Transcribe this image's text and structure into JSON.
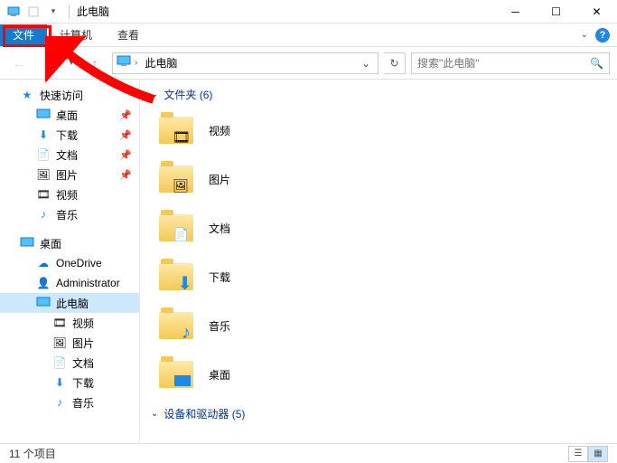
{
  "window": {
    "title": "此电脑"
  },
  "ribbon": {
    "file": "文件",
    "computer": "计算机",
    "view": "查看"
  },
  "address": {
    "crumb": "此电脑",
    "search_placeholder": "搜索\"此电脑\""
  },
  "nav": {
    "quick_access": "快速访问",
    "desktop": "桌面",
    "downloads": "下载",
    "documents": "文档",
    "pictures": "图片",
    "videos": "视频",
    "music": "音乐",
    "desktop2": "桌面",
    "onedrive": "OneDrive",
    "admin": "Administrator",
    "thispc": "此电脑",
    "nav_videos": "视频",
    "nav_pictures": "图片",
    "nav_documents": "文档",
    "nav_downloads": "下载",
    "nav_music": "音乐"
  },
  "groups": {
    "folders_label": "文件夹 (6)",
    "devices_label": "设备和驱动器 (5)"
  },
  "folders": {
    "videos": "视频",
    "pictures": "图片",
    "documents": "文档",
    "downloads": "下载",
    "music": "音乐",
    "desktop": "桌面"
  },
  "status": {
    "items": "11 个项目"
  }
}
